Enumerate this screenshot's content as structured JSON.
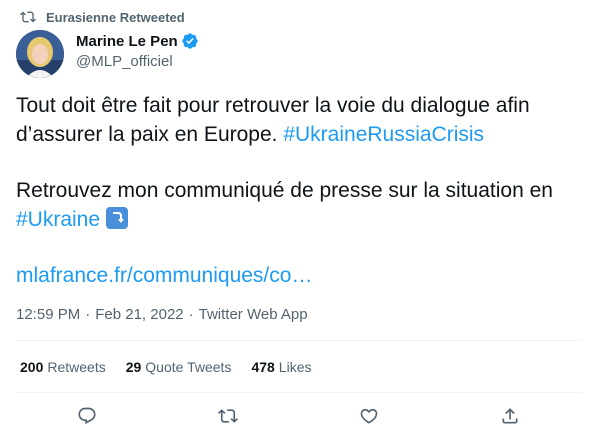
{
  "retweet_notice": {
    "text": "Eurasienne Retweeted",
    "icon": "retweet-icon"
  },
  "author": {
    "name": "Marine Le Pen",
    "handle": "@MLP_officiel",
    "verified": true,
    "verified_color": "#1d9bf0"
  },
  "tweet": {
    "line1_prefix": "Tout doit être fait pour retrouver la voie du dialogue afin d’assurer la paix en Europe. ",
    "hashtag1": "#UkraineRussiaCrisis",
    "line2_prefix": "Retrouvez mon communiqué de presse sur la situation en ",
    "hashtag2": "#Ukraine",
    "emoji": "right-arrow-curving-down",
    "link": "mlafrance.fr/communiques/co…"
  },
  "meta": {
    "time": "12:59 PM",
    "date": "Feb 21, 2022",
    "source": "Twitter Web App",
    "separator": "·"
  },
  "stats": {
    "retweets_count": "200",
    "retweets_label": "Retweets",
    "quotes_count": "29",
    "quotes_label": "Quote Tweets",
    "likes_count": "478",
    "likes_label": "Likes"
  },
  "colors": {
    "accent": "#1d9bf0",
    "text": "#0f1419",
    "muted": "#536471",
    "divider": "#eff3f4"
  }
}
